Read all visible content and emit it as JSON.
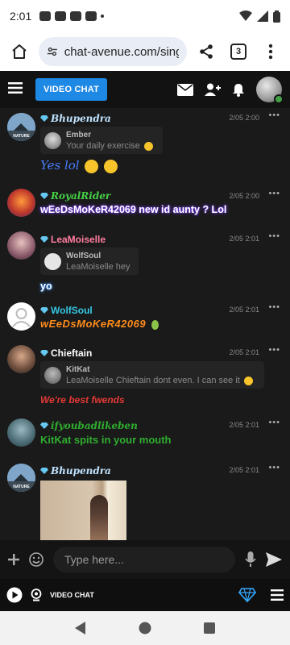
{
  "status_bar": {
    "time": "2:01"
  },
  "browser": {
    "url": "chat-avenue.com/singles",
    "tab_count": "3"
  },
  "app": {
    "video_chat_label": "VIDEO CHAT"
  },
  "messages": [
    {
      "user": "Bhupendra",
      "time": "2/05 2:00",
      "quote_user": "Ember",
      "quote_text": "Your daily exercise",
      "text": "Yes lol"
    },
    {
      "user": "RoyalRider",
      "time": "2/05 2:00",
      "text": "wEeDsMoKeR42069 new id aunty ? Lol"
    },
    {
      "user": "LeaMoiselle",
      "time": "2/05 2:01",
      "quote_user": "WolfSoul",
      "quote_text": "LeaMoiselle hey",
      "text": "yo"
    },
    {
      "user": "WolfSoul",
      "time": "2/05 2:01",
      "text": "wEeDsMoKeR42069"
    },
    {
      "user": "Chieftain",
      "time": "2/05 2:01",
      "quote_user": "KitKat",
      "quote_text": "LeaMoiselle Chieftain dont even. I can see it",
      "text": "We're best fwends"
    },
    {
      "user": "ifyoubadlikeben",
      "time": "2/05 2:01",
      "text": "KitKat spits in your mouth"
    },
    {
      "user": "Bhupendra",
      "time": "2/05 2:01"
    }
  ],
  "avatar_labels": {
    "nature": "NATURE"
  },
  "composer": {
    "placeholder": "Type here..."
  },
  "footer": {
    "video_chat_label": "VIDEO CHAT"
  },
  "colors": {
    "accent": "#1e88e5",
    "chat_bg": "#1a1a1a",
    "header_bg": "#121212",
    "name_bhupendra": "#bfe3ff",
    "name_royalrider": "#45d145",
    "name_leamoiselle": "#ff7da0",
    "name_wolfsoul": "#35c8e6",
    "name_chieftain": "#ffffff",
    "name_ifyoubadlikeben": "#2fae2f"
  }
}
